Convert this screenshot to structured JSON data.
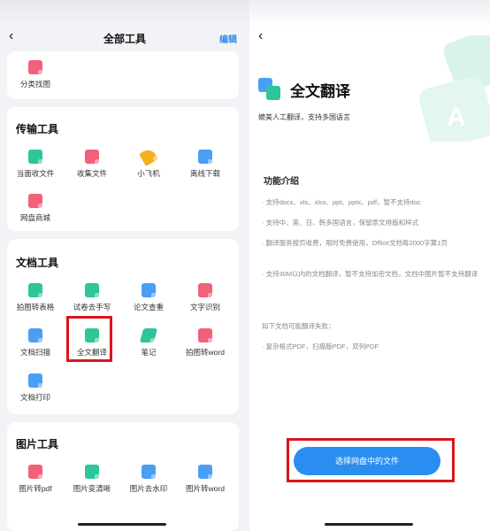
{
  "left": {
    "nav": {
      "back": "‹",
      "title": "全部工具",
      "edit": "编辑"
    },
    "top_card": {
      "tool": {
        "label": "分类找图",
        "icon": "image-search-icon",
        "color": "#f2607a"
      }
    },
    "sections": [
      {
        "title": "传输工具",
        "tools": [
          {
            "label": "当面收文件",
            "icon": "receive-file-icon",
            "color": "#2dc59a"
          },
          {
            "label": "收集文件",
            "icon": "collect-file-icon",
            "color": "#f2607a"
          },
          {
            "label": "小飞机",
            "icon": "paper-plane-icon",
            "color": "#f5b021"
          },
          {
            "label": "离线下载",
            "icon": "offline-download-icon",
            "color": "#4a9ef4"
          },
          {
            "label": "网盘商城",
            "icon": "store-icon",
            "color": "#f2607a"
          }
        ]
      },
      {
        "title": "文档工具",
        "tools": [
          {
            "label": "拍图转表格",
            "icon": "photo-to-table-icon",
            "color": "#2dc59a"
          },
          {
            "label": "试卷去手写",
            "icon": "remove-handwriting-icon",
            "color": "#2dc59a"
          },
          {
            "label": "论文查重",
            "icon": "plagiarism-check-icon",
            "color": "#4a9ef4"
          },
          {
            "label": "文字识别",
            "icon": "ocr-icon",
            "color": "#f2607a"
          },
          {
            "label": "文档扫描",
            "icon": "document-scan-icon",
            "color": "#4a9ef4"
          },
          {
            "label": "全文翻译",
            "icon": "translate-icon",
            "color": "#2dc59a"
          },
          {
            "label": "笔记",
            "icon": "note-icon",
            "color": "#2dc59a"
          },
          {
            "label": "拍图转word",
            "icon": "photo-to-word-icon",
            "color": "#f2607a"
          },
          {
            "label": "文档打印",
            "icon": "print-icon",
            "color": "#4a9ef4"
          }
        ]
      },
      {
        "title": "图片工具",
        "tools": [
          {
            "label": "图片转pdf",
            "icon": "image-to-pdf-icon",
            "color": "#f2607a"
          },
          {
            "label": "图片变清晰",
            "icon": "image-enhance-icon",
            "color": "#2dc59a"
          },
          {
            "label": "图片去水印",
            "icon": "remove-watermark-icon",
            "color": "#4a9ef4"
          },
          {
            "label": "图片转word",
            "icon": "image-to-word-icon",
            "color": "#4a9ef4"
          }
        ]
      }
    ]
  },
  "right": {
    "nav": {
      "back": "‹"
    },
    "feature": {
      "title": "全文翻译",
      "subtitle": "媲美人工翻译，支持多国语言",
      "intro_title": "功能介绍",
      "bullets": [
        "· 支持docx、xls、xlsx、ppt、pptx、pdf，暂不支持doc",
        "· 支持中、英、日、韩多国语言，保留原文排版和样式",
        "· 翻译服务按页收费，限时免费使用，Office文档每2000字算1页",
        "· 支持30M以内的文档翻译，暂不支持加密文档，文档中图片暂不支持翻译"
      ],
      "fail_title": "如下文档可能翻译失败：",
      "fail_items": "· 复杂格式PDF，扫描版PDF，双列PDF",
      "button_label": "选择网盘中的文件"
    }
  },
  "colors": {
    "accent": "#2a8ef0",
    "highlight": "#d9161c",
    "background": "#f2f3f6"
  }
}
